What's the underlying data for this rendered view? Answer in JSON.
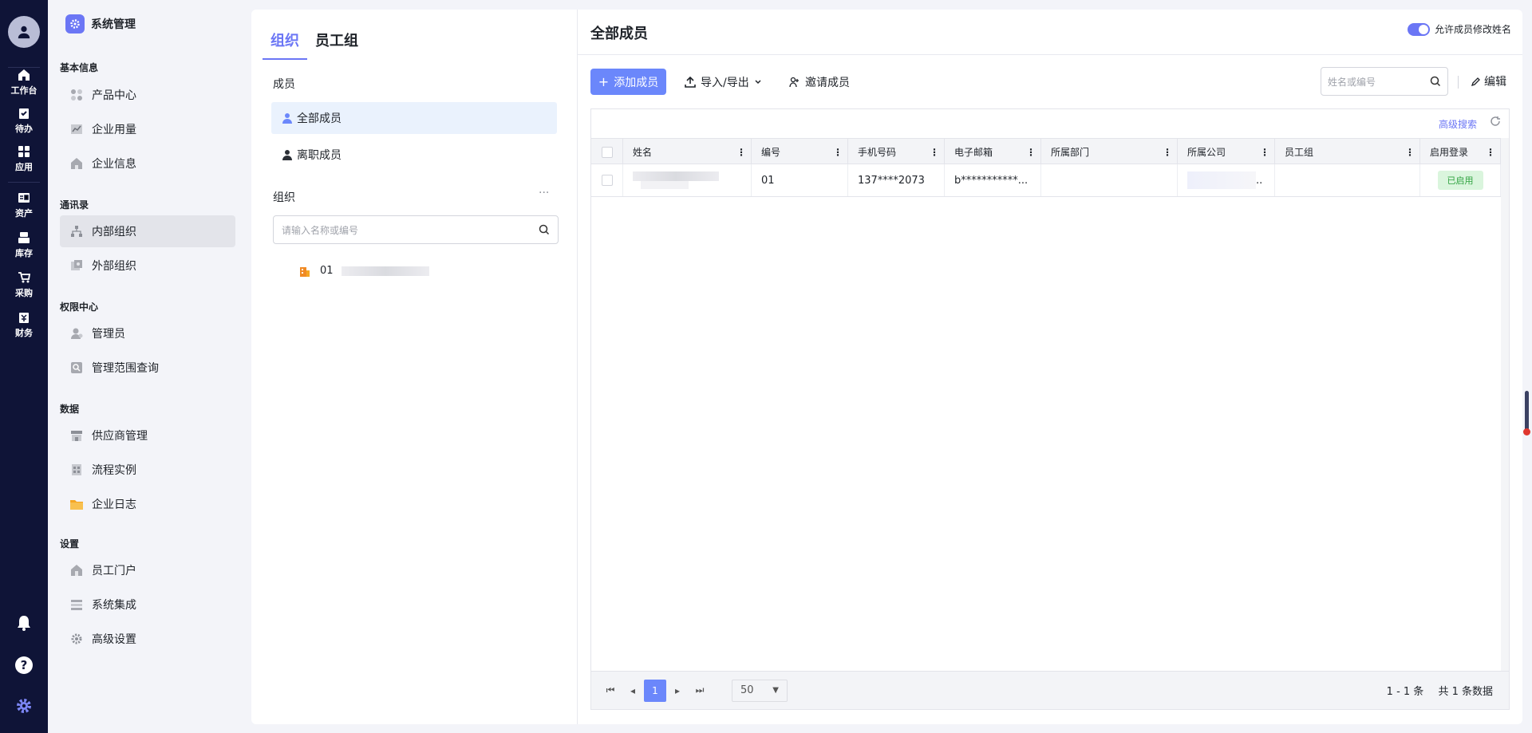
{
  "nav": {
    "items": [
      {
        "label": "工作台",
        "icon": "home-icon"
      },
      {
        "label": "待办",
        "icon": "clipboard-check-icon"
      },
      {
        "label": "应用",
        "icon": "grid-icon"
      },
      {
        "label": "资产",
        "icon": "asset-icon"
      },
      {
        "label": "库存",
        "icon": "inventory-icon"
      },
      {
        "label": "采购",
        "icon": "cart-icon"
      },
      {
        "label": "财务",
        "icon": "finance-icon"
      }
    ]
  },
  "menu": {
    "title": "系统管理",
    "groups": [
      {
        "label": "基本信息",
        "items": [
          "产品中心",
          "企业用量",
          "企业信息"
        ]
      },
      {
        "label": "通讯录",
        "items": [
          "内部组织",
          "外部组织"
        ]
      },
      {
        "label": "权限中心",
        "items": [
          "管理员",
          "管理范围查询"
        ]
      },
      {
        "label": "数据",
        "items": [
          "供应商管理",
          "流程实例",
          "企业日志"
        ]
      },
      {
        "label": "设置",
        "items": [
          "员工门户",
          "系统集成",
          "高级设置"
        ]
      }
    ],
    "active": "内部组织"
  },
  "left": {
    "tabs": [
      "组织",
      "员工组"
    ],
    "members_label": "成员",
    "all_members": "全部成员",
    "left_members": "离职成员",
    "org_label": "组织",
    "more": "···",
    "search_placeholder": "请输入名称或编号",
    "tree_code": "01"
  },
  "right": {
    "title": "全部成员",
    "toggle_label": "允许成员修改姓名",
    "add_button": "添加成员",
    "import_export": "导入/导出",
    "invite": "邀请成员",
    "search_placeholder": "姓名或编号",
    "edit": "编辑",
    "advanced_search": "高级搜索"
  },
  "table": {
    "columns": [
      "姓名",
      "编号",
      "手机号码",
      "电子邮箱",
      "所属部门",
      "所属公司",
      "员工组",
      "启用登录"
    ],
    "rows": [
      {
        "name": "",
        "code": "01",
        "phone": "137****2073",
        "email": "b***********...",
        "dept": "",
        "company": "..",
        "group": "",
        "status": "已启用"
      }
    ]
  },
  "pager": {
    "current": "1",
    "page_size": "50",
    "range": "1 - 1 条",
    "total": "共 1 条数据"
  }
}
